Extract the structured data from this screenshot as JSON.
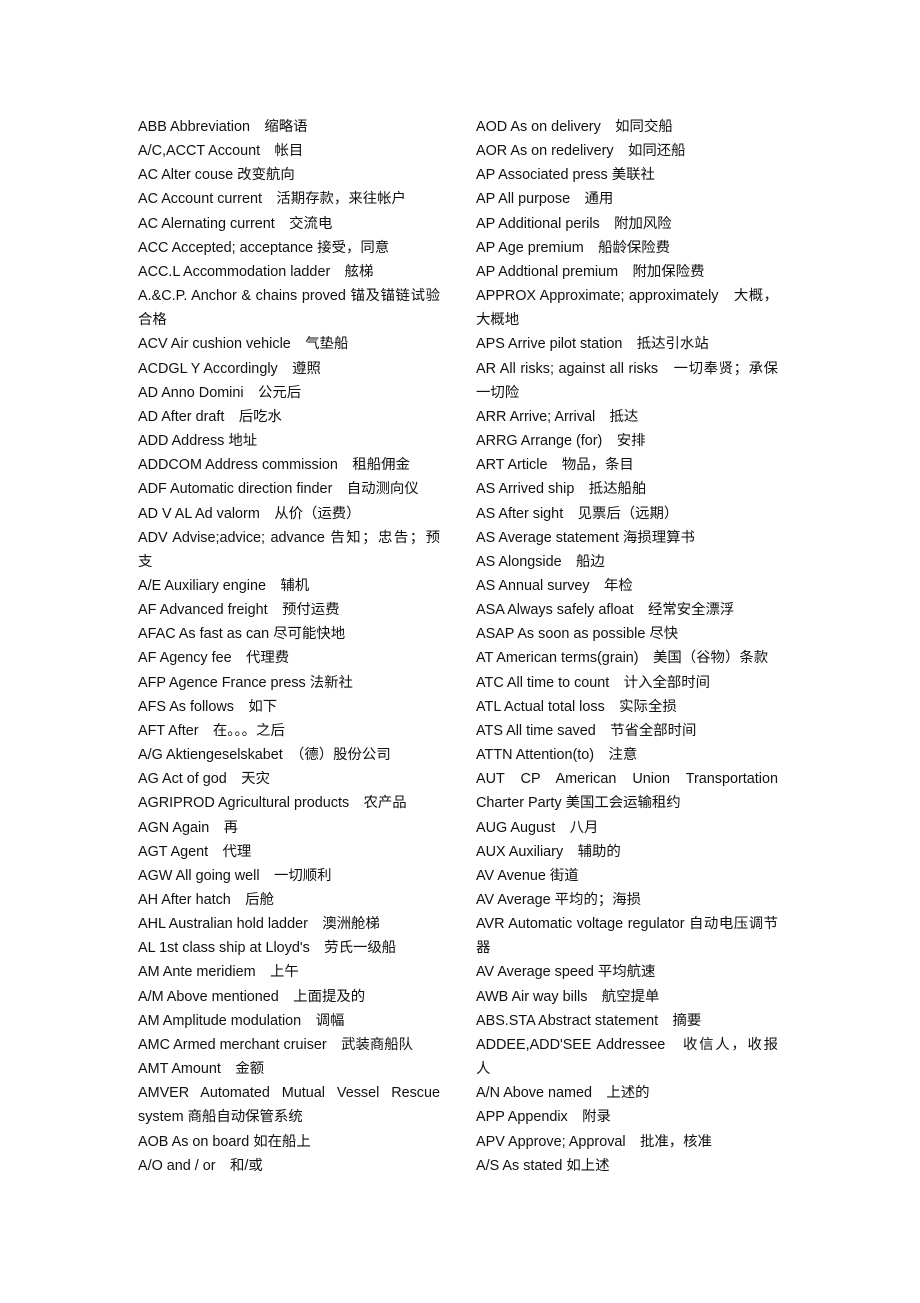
{
  "left_column": [
    "ABB Abbreviation　缩略语",
    "A/C,ACCT Account　帐目",
    "AC Alter couse 改变航向",
    "AC Account current　活期存款，来往帐户",
    "AC Alernating current　交流电",
    "ACC Accepted; acceptance 接受，同意",
    "ACC.L Accommodation ladder　舷梯",
    "A.&C.P.  Anchor  &  chains  proved  锚及锚链试验合格",
    "ACV Air cushion vehicle　气垫船",
    "ACDGL Y Accordingly　遵照",
    "AD Anno Domini　公元后",
    "AD After draft　后吃水",
    "ADD Address 地址",
    "ADDCOM Address commission　租船佣金",
    "ADF Automatic direction finder　自动测向仪",
    "AD V AL Ad valorm　从价（运费）",
    "ADV  Advise;advice;  advance  告知；忠告；预支",
    "A/E Auxiliary engine　辅机",
    "AF Advanced freight　预付运费",
    "AFAC As fast as can 尽可能快地",
    "AF Agency fee　代理费",
    "AFP Agence France press 法新社",
    "AFS As follows　如下",
    "AFT After　在。。。之后",
    "A/G Aktiengeselskabet　（德）股份公司",
    "AG Act of god　天灾",
    "AGRIPROD Agricultural products　农产品",
    "AGN Again　再",
    "AGT Agent　代理",
    "AGW All going well　一切顺利",
    "AH After hatch　后舱",
    "AHL Australian hold ladder　澳洲舱梯",
    "AL 1st class ship at Lloyd's　劳氏一级船",
    "AM Ante meridiem　上午",
    "A/M Above mentioned　上面提及的",
    "AM Amplitude modulation　调幅",
    "AMC Armed merchant cruiser　武装商船队",
    "AMT Amount　金额",
    "AMVER  Automated  Mutual  Vessel  Rescue system 商船自动保管系统",
    "AOB As on board 如在船上",
    "A/O and / or　和/或"
  ],
  "right_column": [
    "AOD As on delivery　如同交船",
    "AOR As on redelivery　如同还船",
    "AP Associated press 美联社",
    "AP All purpose　通用",
    "AP Additional perils　附加风险",
    "AP Age premium　船龄保险费",
    "AP Addtional premium　附加保险费",
    "APPROX Approximate; approximately　大概，大概地",
    "APS Arrive pilot station　抵达引水站",
    "AR All risks; against all risks　一切奉贤；承保一切险",
    "ARR Arrive; Arrival　抵达",
    "ARRG Arrange (for)　安排",
    "ART Article　物品，条目",
    "AS Arrived ship　抵达船舶",
    "AS After sight　见票后（远期）",
    "AS Average statement 海损理算书",
    "AS Alongside　船边",
    "AS Annual survey　年检",
    "ASA Always safely afloat　经常安全漂浮",
    "ASAP As soon as possible 尽快",
    "AT American terms(grain)　美国（谷物）条款",
    "ATC All time to count　计入全部时间",
    "ATL Actual total loss　实际全损",
    "ATS All time saved　节省全部时间",
    "ATTN Attention(to)　注意",
    "AUT  CP  American  Union  Transportation Charter Party 美国工会运输租约",
    "AUG August　八月",
    "AUX Auxiliary　辅助的",
    "AV Avenue 街道",
    "AV Average 平均的；海损",
    "AVR  Automatic  voltage  regulator  自动电压调节器",
    "AV Average speed 平均航速",
    "AWB Air way bills　航空提单",
    "ABS.STA Abstract statement　摘要",
    "ADDEE,ADD'SEE Addressee　收信人，收报人",
    "A/N Above named　上述的",
    "APP Appendix　附录",
    "APV Approve; Approval　批准，核准",
    "A/S As stated 如上述"
  ]
}
